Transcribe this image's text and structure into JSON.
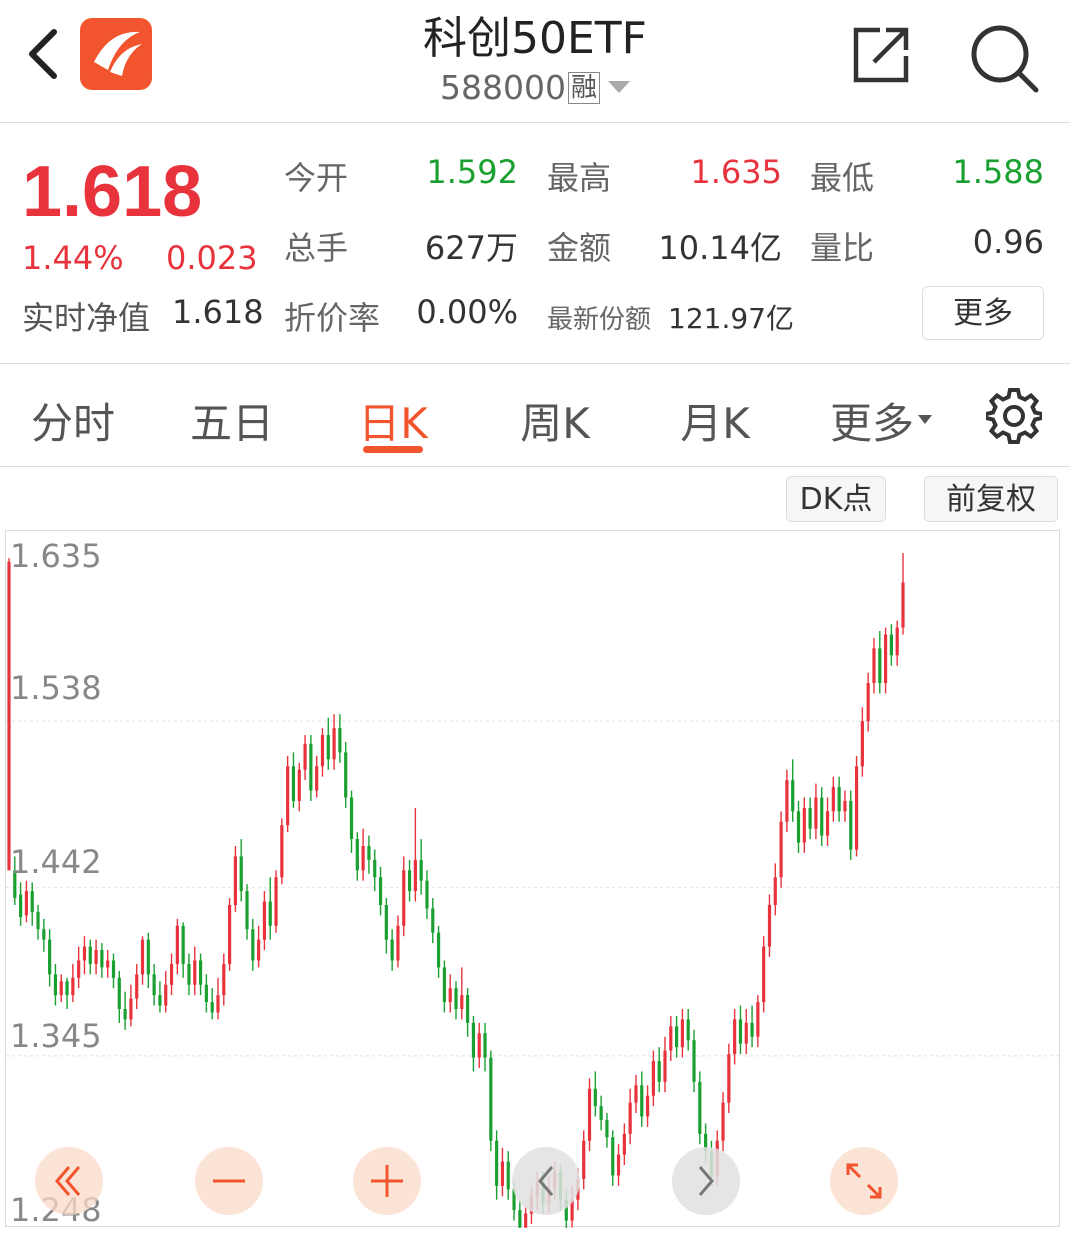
{
  "header": {
    "title": "科创50ETF",
    "code": "588000",
    "badge": "融"
  },
  "quote": {
    "price": "1.618",
    "change_pct": "1.44%",
    "change_abs": "0.023",
    "nav_label": "实时净值",
    "nav_value": "1.618",
    "fields": {
      "open": {
        "label": "今开",
        "value": "1.592"
      },
      "high": {
        "label": "最高",
        "value": "1.635"
      },
      "low": {
        "label": "最低",
        "value": "1.588"
      },
      "volume": {
        "label": "总手",
        "value": "627万"
      },
      "amount": {
        "label": "金额",
        "value": "10.14亿"
      },
      "volume_ratio": {
        "label": "量比",
        "value": "0.96"
      },
      "premium": {
        "label": "折价率",
        "value": "0.00%"
      },
      "shares": {
        "label": "最新份额",
        "value": "121.97亿"
      }
    },
    "more_label": "更多",
    "colors": {
      "up": "#e8333c",
      "down": "#1aa030",
      "accent": "#f2542d"
    }
  },
  "tabs": {
    "items": [
      "分时",
      "五日",
      "日K",
      "周K",
      "月K",
      "更多"
    ],
    "active": "日K"
  },
  "toolbar": {
    "dk_label": "DK点",
    "adjust_label": "前复权"
  },
  "chart_data": {
    "type": "candlestick",
    "y_tick_labels": [
      "1.635",
      "1.538",
      "1.442",
      "1.345",
      "1.248"
    ],
    "ylim": [
      1.248,
      1.635
    ],
    "grid": true,
    "candles": [
      [
        1.452,
        1.63,
        1.452,
        1.632
      ],
      [
        1.452,
        1.436,
        1.432,
        1.46
      ],
      [
        1.438,
        1.425,
        1.42,
        1.445
      ],
      [
        1.426,
        1.44,
        1.422,
        1.446
      ],
      [
        1.44,
        1.428,
        1.42,
        1.445
      ],
      [
        1.428,
        1.418,
        1.412,
        1.432
      ],
      [
        1.418,
        1.412,
        1.405,
        1.424
      ],
      [
        1.412,
        1.392,
        1.385,
        1.418
      ],
      [
        1.392,
        1.38,
        1.374,
        1.398
      ],
      [
        1.38,
        1.388,
        1.376,
        1.392
      ],
      [
        1.388,
        1.38,
        1.372,
        1.39
      ],
      [
        1.38,
        1.39,
        1.376,
        1.398
      ],
      [
        1.39,
        1.4,
        1.384,
        1.408
      ],
      [
        1.4,
        1.408,
        1.392,
        1.414
      ],
      [
        1.408,
        1.398,
        1.392,
        1.412
      ],
      [
        1.398,
        1.406,
        1.392,
        1.412
      ],
      [
        1.406,
        1.396,
        1.39,
        1.41
      ],
      [
        1.396,
        1.4,
        1.39,
        1.406
      ],
      [
        1.4,
        1.39,
        1.384,
        1.404
      ],
      [
        1.39,
        1.372,
        1.364,
        1.394
      ],
      [
        1.372,
        1.366,
        1.36,
        1.382
      ],
      [
        1.366,
        1.378,
        1.362,
        1.386
      ],
      [
        1.378,
        1.392,
        1.372,
        1.398
      ],
      [
        1.392,
        1.412,
        1.386,
        1.414
      ],
      [
        1.412,
        1.392,
        1.384,
        1.416
      ],
      [
        1.392,
        1.38,
        1.374,
        1.398
      ],
      [
        1.38,
        1.374,
        1.37,
        1.388
      ],
      [
        1.374,
        1.386,
        1.37,
        1.394
      ],
      [
        1.386,
        1.398,
        1.38,
        1.404
      ],
      [
        1.398,
        1.42,
        1.392,
        1.424
      ],
      [
        1.42,
        1.398,
        1.39,
        1.422
      ],
      [
        1.398,
        1.386,
        1.38,
        1.404
      ],
      [
        1.386,
        1.4,
        1.38,
        1.408
      ],
      [
        1.4,
        1.386,
        1.38,
        1.404
      ],
      [
        1.386,
        1.376,
        1.37,
        1.392
      ],
      [
        1.376,
        1.37,
        1.366,
        1.384
      ],
      [
        1.37,
        1.38,
        1.366,
        1.39
      ],
      [
        1.38,
        1.398,
        1.374,
        1.404
      ],
      [
        1.398,
        1.432,
        1.394,
        1.436
      ],
      [
        1.432,
        1.46,
        1.428,
        1.466
      ],
      [
        1.46,
        1.44,
        1.434,
        1.47
      ],
      [
        1.44,
        1.418,
        1.412,
        1.444
      ],
      [
        1.418,
        1.4,
        1.394,
        1.424
      ],
      [
        1.4,
        1.412,
        1.396,
        1.42
      ],
      [
        1.412,
        1.434,
        1.406,
        1.44
      ],
      [
        1.434,
        1.42,
        1.412,
        1.448
      ],
      [
        1.42,
        1.448,
        1.416,
        1.452
      ],
      [
        1.448,
        1.478,
        1.444,
        1.482
      ],
      [
        1.478,
        1.512,
        1.474,
        1.518
      ],
      [
        1.512,
        1.492,
        1.488,
        1.52
      ],
      [
        1.492,
        1.51,
        1.486,
        1.514
      ],
      [
        1.51,
        1.525,
        1.504,
        1.53
      ],
      [
        1.525,
        1.498,
        1.492,
        1.53
      ],
      [
        1.498,
        1.512,
        1.494,
        1.518
      ],
      [
        1.512,
        1.53,
        1.506,
        1.534
      ],
      [
        1.53,
        1.516,
        1.51,
        1.54
      ],
      [
        1.516,
        1.534,
        1.51,
        1.542
      ],
      [
        1.534,
        1.52,
        1.514,
        1.542
      ],
      [
        1.52,
        1.494,
        1.488,
        1.526
      ],
      [
        1.494,
        1.47,
        1.462,
        1.498
      ],
      [
        1.47,
        1.452,
        1.446,
        1.474
      ],
      [
        1.452,
        1.466,
        1.446,
        1.476
      ],
      [
        1.466,
        1.458,
        1.45,
        1.472
      ],
      [
        1.458,
        1.448,
        1.44,
        1.464
      ],
      [
        1.448,
        1.432,
        1.426,
        1.454
      ],
      [
        1.432,
        1.412,
        1.404,
        1.436
      ],
      [
        1.412,
        1.4,
        1.394,
        1.418
      ],
      [
        1.4,
        1.42,
        1.396,
        1.426
      ],
      [
        1.42,
        1.452,
        1.414,
        1.46
      ],
      [
        1.452,
        1.44,
        1.434,
        1.458
      ],
      [
        1.44,
        1.458,
        1.434,
        1.488
      ],
      [
        1.458,
        1.446,
        1.438,
        1.47
      ],
      [
        1.446,
        1.43,
        1.424,
        1.452
      ],
      [
        1.43,
        1.416,
        1.41,
        1.436
      ],
      [
        1.416,
        1.396,
        1.39,
        1.42
      ],
      [
        1.396,
        1.376,
        1.37,
        1.4
      ],
      [
        1.376,
        1.384,
        1.37,
        1.392
      ],
      [
        1.384,
        1.372,
        1.366,
        1.388
      ],
      [
        1.372,
        1.38,
        1.366,
        1.396
      ],
      [
        1.38,
        1.364,
        1.356,
        1.384
      ],
      [
        1.364,
        1.344,
        1.336,
        1.368
      ],
      [
        1.344,
        1.358,
        1.338,
        1.364
      ],
      [
        1.358,
        1.344,
        1.336,
        1.364
      ],
      [
        1.344,
        1.296,
        1.29,
        1.348
      ],
      [
        1.296,
        1.27,
        1.262,
        1.302
      ],
      [
        1.27,
        1.284,
        1.264,
        1.292
      ],
      [
        1.284,
        1.268,
        1.262,
        1.29
      ],
      [
        1.268,
        1.256,
        1.25,
        1.272
      ],
      [
        1.256,
        1.246,
        1.24,
        1.262
      ],
      [
        1.246,
        1.254,
        1.24,
        1.258
      ],
      [
        1.254,
        1.264,
        1.248,
        1.27
      ],
      [
        1.264,
        1.272,
        1.256,
        1.278
      ],
      [
        1.272,
        1.26,
        1.254,
        1.278
      ],
      [
        1.26,
        1.268,
        1.254,
        1.276
      ],
      [
        1.268,
        1.278,
        1.262,
        1.284
      ],
      [
        1.278,
        1.262,
        1.256,
        1.282
      ],
      [
        1.262,
        1.25,
        1.244,
        1.268
      ],
      [
        1.25,
        1.262,
        1.246,
        1.27
      ],
      [
        1.262,
        1.274,
        1.256,
        1.28
      ],
      [
        1.274,
        1.296,
        1.268,
        1.302
      ],
      [
        1.296,
        1.326,
        1.29,
        1.332
      ],
      [
        1.326,
        1.316,
        1.31,
        1.336
      ],
      [
        1.316,
        1.308,
        1.302,
        1.322
      ],
      [
        1.308,
        1.298,
        1.292,
        1.312
      ],
      [
        1.298,
        1.276,
        1.27,
        1.302
      ],
      [
        1.276,
        1.288,
        1.27,
        1.294
      ],
      [
        1.288,
        1.3,
        1.282,
        1.306
      ],
      [
        1.3,
        1.318,
        1.294,
        1.326
      ],
      [
        1.318,
        1.328,
        1.312,
        1.334
      ],
      [
        1.328,
        1.31,
        1.304,
        1.336
      ],
      [
        1.31,
        1.322,
        1.304,
        1.328
      ],
      [
        1.322,
        1.342,
        1.316,
        1.348
      ],
      [
        1.342,
        1.33,
        1.324,
        1.35
      ],
      [
        1.33,
        1.348,
        1.324,
        1.356
      ],
      [
        1.348,
        1.362,
        1.342,
        1.368
      ],
      [
        1.362,
        1.35,
        1.344,
        1.368
      ],
      [
        1.35,
        1.366,
        1.344,
        1.372
      ],
      [
        1.366,
        1.354,
        1.348,
        1.372
      ],
      [
        1.354,
        1.33,
        1.324,
        1.36
      ],
      [
        1.33,
        1.3,
        1.294,
        1.336
      ],
      [
        1.3,
        1.29,
        1.284,
        1.306
      ],
      [
        1.29,
        1.276,
        1.27,
        1.296
      ],
      [
        1.276,
        1.296,
        1.27,
        1.302
      ],
      [
        1.296,
        1.318,
        1.29,
        1.324
      ],
      [
        1.318,
        1.346,
        1.312,
        1.352
      ],
      [
        1.346,
        1.366,
        1.34,
        1.372
      ],
      [
        1.366,
        1.352,
        1.346,
        1.374
      ],
      [
        1.352,
        1.364,
        1.346,
        1.372
      ],
      [
        1.364,
        1.356,
        1.35,
        1.374
      ],
      [
        1.356,
        1.376,
        1.35,
        1.38
      ],
      [
        1.376,
        1.408,
        1.37,
        1.414
      ],
      [
        1.408,
        1.432,
        1.402,
        1.438
      ],
      [
        1.432,
        1.448,
        1.426,
        1.456
      ],
      [
        1.448,
        1.48,
        1.442,
        1.486
      ],
      [
        1.48,
        1.504,
        1.474,
        1.51
      ],
      [
        1.504,
        1.486,
        1.48,
        1.516
      ],
      [
        1.486,
        1.468,
        1.462,
        1.492
      ],
      [
        1.468,
        1.488,
        1.462,
        1.494
      ],
      [
        1.488,
        1.476,
        1.47,
        1.494
      ],
      [
        1.476,
        1.494,
        1.47,
        1.502
      ],
      [
        1.494,
        1.472,
        1.466,
        1.5
      ],
      [
        1.472,
        1.486,
        1.466,
        1.494
      ],
      [
        1.486,
        1.5,
        1.48,
        1.506
      ],
      [
        1.5,
        1.486,
        1.48,
        1.506
      ],
      [
        1.486,
        1.492,
        1.48,
        1.498
      ],
      [
        1.492,
        1.464,
        1.458,
        1.498
      ],
      [
        1.464,
        1.512,
        1.46,
        1.518
      ],
      [
        1.512,
        1.538,
        1.506,
        1.546
      ],
      [
        1.538,
        1.56,
        1.532,
        1.566
      ],
      [
        1.56,
        1.58,
        1.554,
        1.586
      ],
      [
        1.58,
        1.56,
        1.554,
        1.59
      ],
      [
        1.56,
        1.588,
        1.554,
        1.592
      ],
      [
        1.588,
        1.576,
        1.57,
        1.594
      ],
      [
        1.576,
        1.592,
        1.57,
        1.596
      ],
      [
        1.592,
        1.618,
        1.588,
        1.635
      ]
    ]
  },
  "controls": {
    "prev_page": "double-chevron-left-icon",
    "zoom_out": "minus-icon",
    "zoom_in": "plus-icon",
    "scroll_left": "chevron-left-icon",
    "scroll_right": "chevron-right-icon",
    "fullscreen": "expand-icon"
  }
}
